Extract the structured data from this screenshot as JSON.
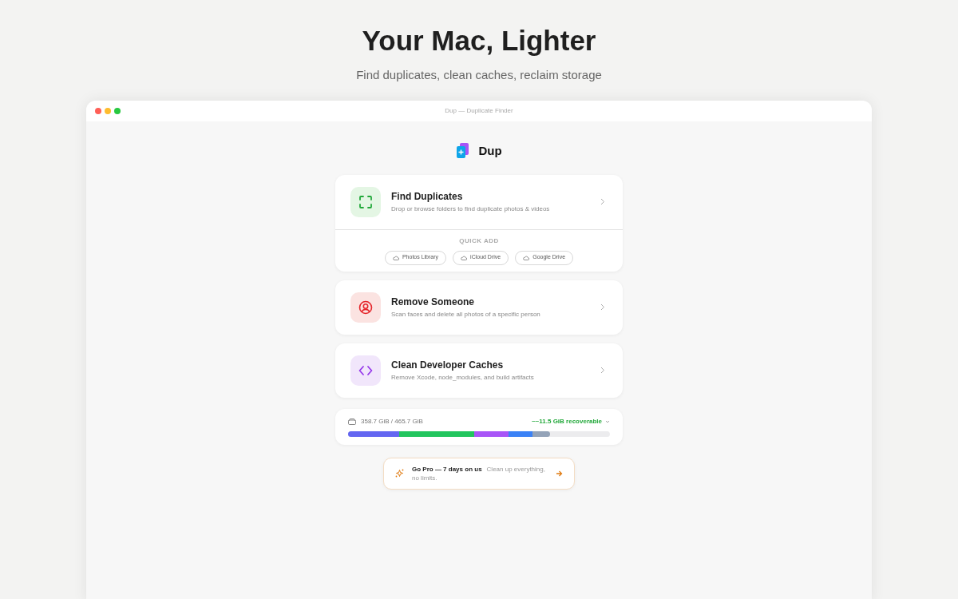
{
  "hero": {
    "title": "Your Mac, Lighter",
    "subtitle": "Find duplicates, clean caches, reclaim storage"
  },
  "window": {
    "title": "Dup — Duplicate Finder"
  },
  "app": {
    "name": "Dup"
  },
  "cards": [
    {
      "kind": "duplicates",
      "title": "Find Duplicates",
      "description": "Drop or browse folders to find duplicate photos & videos",
      "quick_add": {
        "label": "QUICK ADD",
        "sources": [
          "Photos Library",
          "iCloud Drive",
          "Google Drive"
        ]
      }
    },
    {
      "kind": "person",
      "title": "Remove Someone",
      "description": "Scan faces and delete all photos of a specific person"
    },
    {
      "kind": "code",
      "title": "Clean Developer Caches",
      "description": "Remove Xcode, node_modules, and build artifacts"
    }
  ],
  "storage": {
    "usage": "358.7 GiB / 465.7 GiB",
    "recoverable": "~~11.5 GiB recoverable",
    "segments": [
      {
        "color": "#6366f1"
      },
      {
        "color": "#22c55e"
      },
      {
        "color": "#a855f7"
      },
      {
        "color": "#3b82f6"
      },
      {
        "color": "#94a3b8"
      }
    ]
  },
  "promo": {
    "title": "Go Pro — 7 days on us",
    "text": "Clean up everything, no limits."
  }
}
